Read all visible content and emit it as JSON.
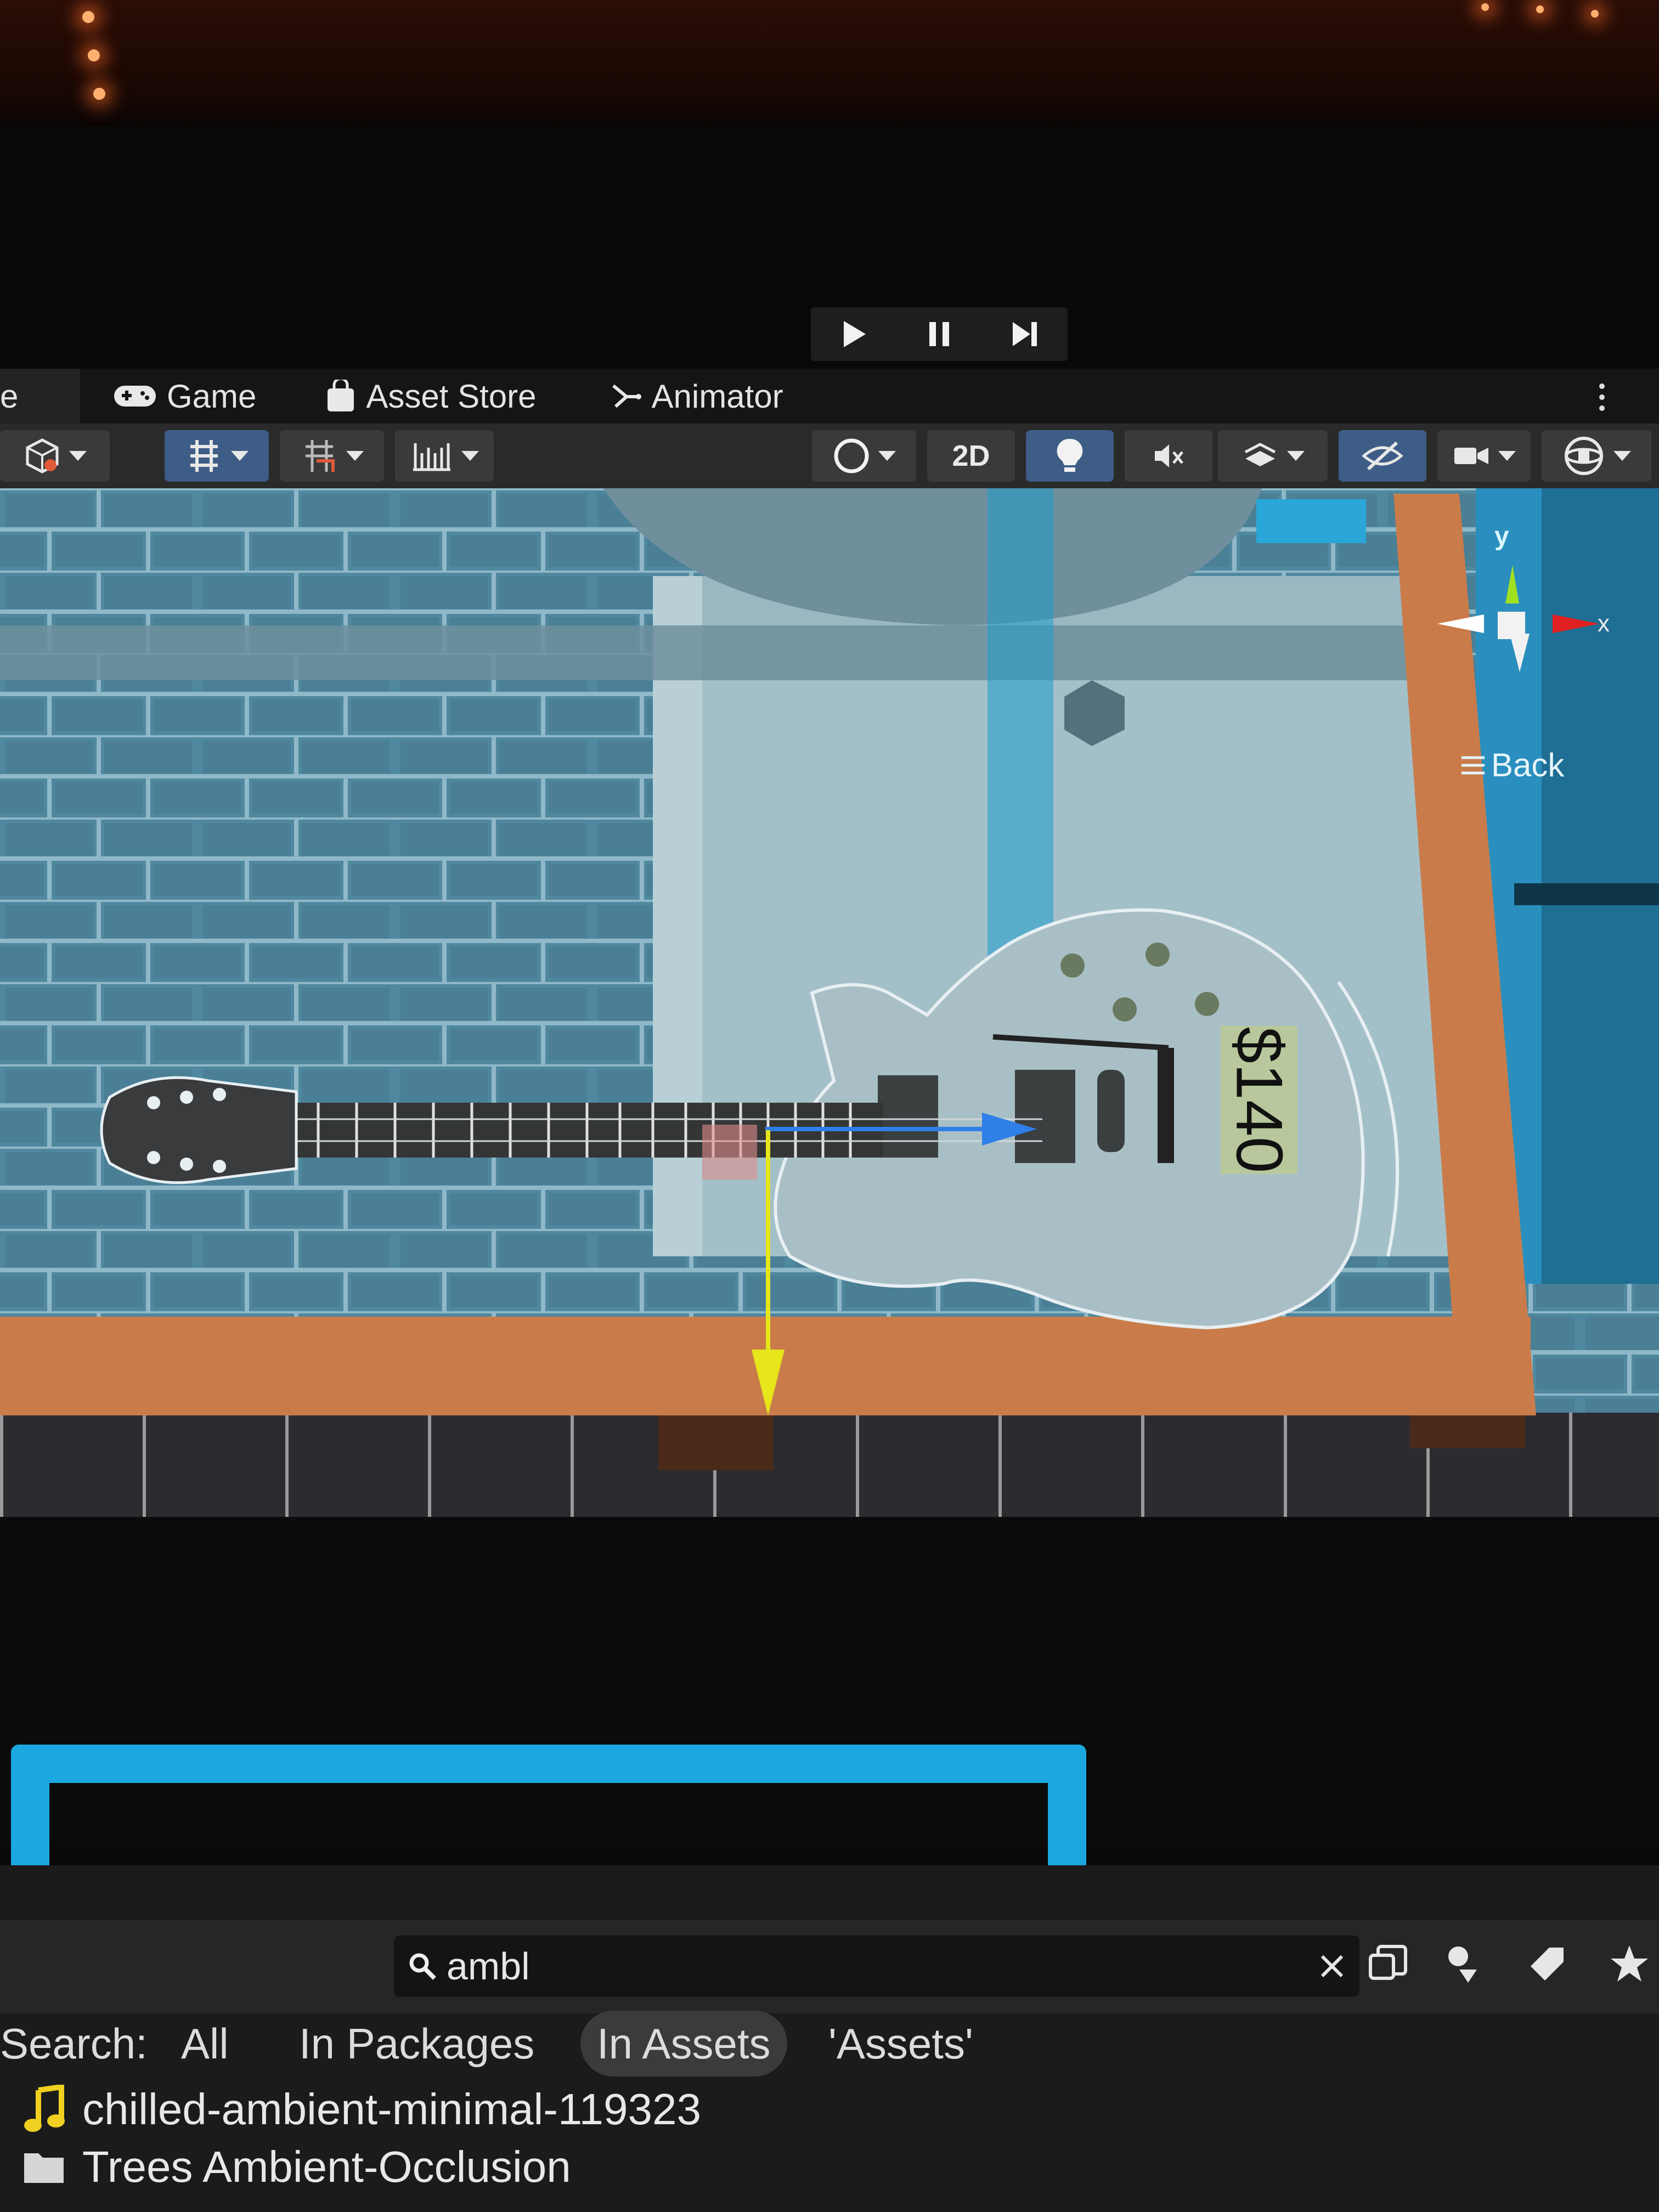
{
  "playbar": {
    "play": "play-icon",
    "pause": "pause-icon",
    "step": "step-icon"
  },
  "tabs": [
    {
      "label": "e",
      "icon": ""
    },
    {
      "label": "Game",
      "icon": "gamepad-icon"
    },
    {
      "label": "Asset Store",
      "icon": "bag-icon"
    },
    {
      "label": "Animator",
      "icon": "animator-icon"
    }
  ],
  "toolbar": {
    "mode_2d": "2D",
    "icons": [
      "cube-icon",
      "grid-snap-icon",
      "move-snap-icon",
      "ruler-icon",
      "shading-circle-icon",
      "light-icon",
      "audio-mute-icon",
      "effects-icon",
      "hidden-objects-icon",
      "camera-icon",
      "gizmos-icon"
    ]
  },
  "scene": {
    "price_tag": "$140",
    "gizmo": {
      "y_label": "y",
      "x_label": "x",
      "view_label": "Back"
    },
    "colors": {
      "wall": "#5b8ea5",
      "shelf": "#c97c4a",
      "axis_y": "#e6e61a",
      "axis_z": "#2f7fe8",
      "axis_x": "#e02020"
    }
  },
  "project": {
    "search_value": "ambl",
    "search_label": "Search:",
    "filters": [
      "All",
      "In Packages",
      "In Assets",
      "'Assets'"
    ],
    "active_filter": "In Assets",
    "results": [
      {
        "name": "chilled-ambient-minimal-119323",
        "icon": "music-note-icon"
      },
      {
        "name": "Trees Ambient-Occlusion",
        "icon": "folder-icon"
      }
    ]
  }
}
